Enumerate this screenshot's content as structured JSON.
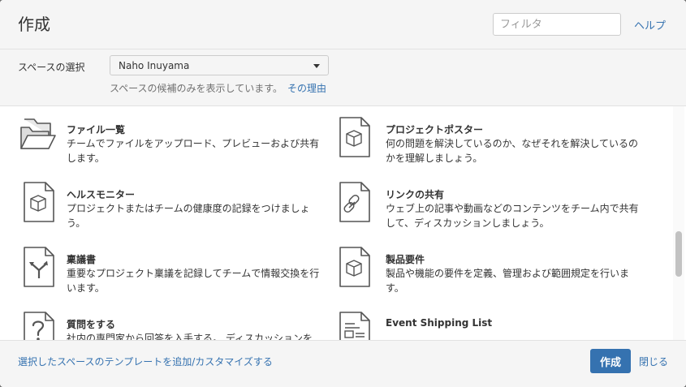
{
  "header": {
    "title": "作成",
    "filter_placeholder": "フィルタ",
    "help_label": "ヘルプ"
  },
  "space": {
    "label": "スペースの選択",
    "selected": "Naho Inuyama",
    "hint": "スペースの候補のみを表示しています。",
    "hint_link": "その理由"
  },
  "templates": [
    {
      "name": "ファイル一覧",
      "description": "チームでファイルをアップロード、プレビューおよび共有します。",
      "icon": "folder-icon"
    },
    {
      "name": "プロジェクトポスター",
      "description": "何の問題を解決しているのか、なぜそれを解決しているのかを理解しましょう。",
      "icon": "box-document-icon"
    },
    {
      "name": "ヘルスモニター",
      "description": "プロジェクトまたはチームの健康度の記録をつけましょう。",
      "icon": "box-document-icon"
    },
    {
      "name": "リンクの共有",
      "description": "ウェブ上の記事や動画などのコンテンツをチーム内で共有して、ディスカッションしましょう。",
      "icon": "link-document-icon"
    },
    {
      "name": "稟議書",
      "description": "重要なプロジェクト稟議を記録してチームで情報交換を行います。",
      "icon": "merge-arrows-document-icon"
    },
    {
      "name": "製品要件",
      "description": "製品や機能の要件を定義、管理および範囲規定を行います。",
      "icon": "box-document-icon"
    },
    {
      "name": "質問をする",
      "description": "社内の専門家から回答を入手する。 ディスカッションを",
      "icon": "question-document-icon"
    },
    {
      "name": "Event Shipping List",
      "description": "",
      "icon": "page-layout-document-icon"
    }
  ],
  "footer": {
    "customize_link": "選択したスペースのテンプレートを追加/カスタマイズする",
    "create_label": "作成",
    "close_label": "閉じる"
  },
  "colors": {
    "accent": "#3572b0",
    "icon_stroke": "#555555"
  }
}
